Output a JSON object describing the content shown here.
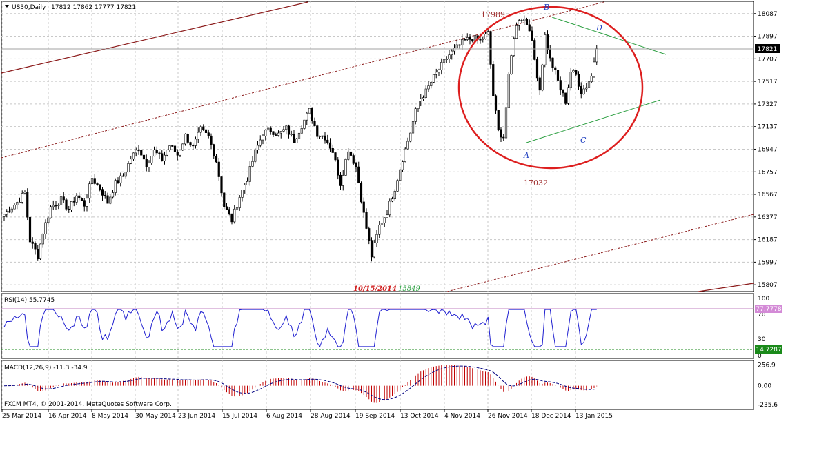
{
  "window": {
    "title": "US30,Daily",
    "ohlc": "17812 17862 17777 17821",
    "copyright": "FXCM MT4, © 2001-2014, MetaQuotes Software Corp."
  },
  "colors": {
    "bull_candle": "#ffffff",
    "bear_candle": "#000000",
    "rsi_line": "#1f1fd0",
    "macd_hist": "#c00000",
    "macd_signal": "#000080",
    "channel": "#8b1a1a",
    "triangle": "#2ea043",
    "circle": "#dd1f1f",
    "rsi_upper_label_bg": "#d38ad6",
    "rsi_lower_label_bg": "#1a8a1a"
  },
  "chart_data": {
    "type": "candlestick",
    "symbol": "US30",
    "timeframe": "Daily",
    "price_axis": {
      "ylim": [
        15750,
        18190
      ],
      "ticks": [
        15807,
        15997,
        16187,
        16377,
        16567,
        16757,
        16947,
        17137,
        17327,
        17517,
        17707,
        17897,
        18087
      ],
      "current": 17821
    },
    "x_labels": [
      "25 Mar 2014",
      "16 Apr 2014",
      "8 May 2014",
      "30 May 2014",
      "23 Jun 2014",
      "15 Jul 2014",
      "6 Aug 2014",
      "28 Aug 2014",
      "19 Sep 2014",
      "13 Oct 2014",
      "4 Nov 2014",
      "26 Nov 2014",
      "18 Dec 2014",
      "13 Jan 2015"
    ],
    "close_path": [
      [
        0,
        16400
      ],
      [
        5,
        16500
      ],
      [
        8,
        16580
      ],
      [
        10,
        16180
      ],
      [
        13,
        16050
      ],
      [
        15,
        16250
      ],
      [
        18,
        16460
      ],
      [
        22,
        16520
      ],
      [
        25,
        16440
      ],
      [
        28,
        16560
      ],
      [
        31,
        16480
      ],
      [
        34,
        16700
      ],
      [
        37,
        16620
      ],
      [
        40,
        16500
      ],
      [
        43,
        16660
      ],
      [
        46,
        16720
      ],
      [
        49,
        16870
      ],
      [
        52,
        16960
      ],
      [
        55,
        16820
      ],
      [
        58,
        16930
      ],
      [
        61,
        16860
      ],
      [
        64,
        16980
      ],
      [
        67,
        16900
      ],
      [
        70,
        17060
      ],
      [
        73,
        16960
      ],
      [
        76,
        17110
      ],
      [
        79,
        17050
      ],
      [
        82,
        16850
      ],
      [
        85,
        16470
      ],
      [
        88,
        16350
      ],
      [
        91,
        16550
      ],
      [
        94,
        16700
      ],
      [
        97,
        16920
      ],
      [
        100,
        17080
      ],
      [
        103,
        17110
      ],
      [
        106,
        17070
      ],
      [
        109,
        17120
      ],
      [
        112,
        17020
      ],
      [
        115,
        17150
      ],
      [
        118,
        17270
      ],
      [
        121,
        17080
      ],
      [
        124,
        17050
      ],
      [
        127,
        16930
      ],
      [
        130,
        16660
      ],
      [
        133,
        16950
      ],
      [
        136,
        16800
      ],
      [
        139,
        16400
      ],
      [
        142,
        16050
      ],
      [
        145,
        16300
      ],
      [
        148,
        16420
      ],
      [
        151,
        16620
      ],
      [
        154,
        16870
      ],
      [
        157,
        17090
      ],
      [
        160,
        17350
      ],
      [
        163,
        17430
      ],
      [
        166,
        17550
      ],
      [
        169,
        17650
      ],
      [
        172,
        17740
      ],
      [
        175,
        17800
      ],
      [
        178,
        17860
      ],
      [
        181,
        17880
      ],
      [
        184,
        17860
      ],
      [
        187,
        17920
      ],
      [
        189,
        17400
      ],
      [
        191,
        17100
      ],
      [
        193,
        17050
      ],
      [
        195,
        17550
      ],
      [
        197,
        17900
      ],
      [
        199,
        18050
      ],
      [
        201,
        18040
      ],
      [
        203,
        17970
      ],
      [
        205,
        17700
      ],
      [
        207,
        17450
      ],
      [
        209,
        17900
      ],
      [
        211,
        17700
      ],
      [
        213,
        17590
      ],
      [
        215,
        17450
      ],
      [
        217,
        17350
      ],
      [
        219,
        17600
      ],
      [
        221,
        17570
      ],
      [
        223,
        17430
      ],
      [
        225,
        17480
      ],
      [
        227,
        17560
      ],
      [
        229,
        17821
      ]
    ],
    "annotations": {
      "high_label": "17989",
      "low_label": "17032",
      "bottom_date": "10/15/2014",
      "bottom_price": "15849",
      "point_a": "A",
      "point_b": "B",
      "point_c": "C",
      "point_d": "D"
    },
    "rsi": {
      "label": "RSI(14) 55.7745",
      "ylim": [
        0,
        100
      ],
      "ticks": [
        "100",
        "70",
        "30",
        "0"
      ],
      "upper_value": "77.7778",
      "lower_value": "14.7287"
    },
    "macd": {
      "label": "MACD(12,26,9) -11.3 -34.9",
      "ticks": [
        "256.9",
        "0.00",
        "-235.6"
      ],
      "ylim": [
        -260,
        280
      ]
    }
  }
}
